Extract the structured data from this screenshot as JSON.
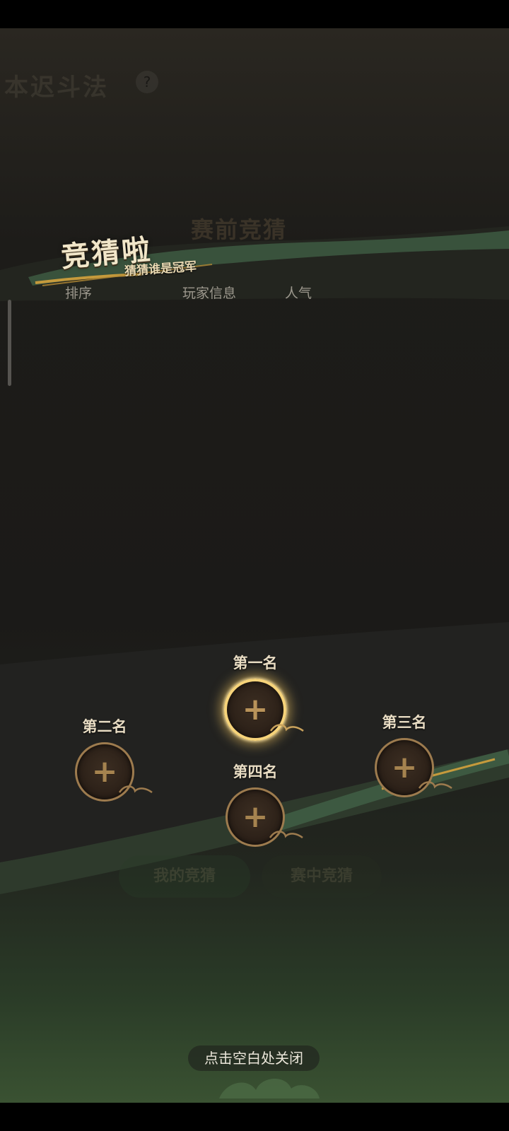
{
  "background_title": "本迟斗法",
  "background_help_icon": "?",
  "background_subtitle": "赛前竞猜",
  "banner": {
    "title": "竞猜啦",
    "subtitle": "猜猜谁是冠军"
  },
  "table": {
    "columns": [
      "排序",
      "玩家信息",
      "人气"
    ]
  },
  "podium": {
    "rank1_label": "第一名",
    "rank2_label": "第二名",
    "rank3_label": "第三名",
    "rank4_label": "第四名",
    "plus_glyph": "+"
  },
  "background_tabs": [
    "我的竞猜",
    "赛中竞猜"
  ],
  "close_hint": "点击空白处关闭",
  "colors": {
    "gold": "#f6d37a",
    "panel_dark": "#1b1a18",
    "ink_green": "#3f5d44"
  }
}
